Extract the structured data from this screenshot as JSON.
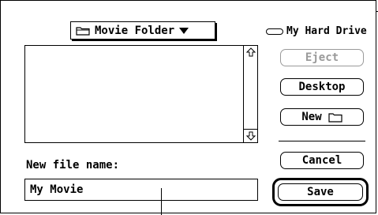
{
  "folder_popup": {
    "label": "Movie Folder",
    "icon": "folder-icon",
    "indicator": "chevron-down-icon"
  },
  "drive": {
    "label": "My Hard Drive",
    "icon": "hard-drive-icon"
  },
  "file_list": {
    "items": []
  },
  "buttons": {
    "eject": "Eject",
    "desktop": "Desktop",
    "new": "New",
    "cancel": "Cancel",
    "save": "Save"
  },
  "filename": {
    "label": "New file name:",
    "value": "My Movie"
  },
  "colors": {
    "text": "#000000",
    "disabled": "#9a9a9a",
    "background": "#ffffff"
  }
}
